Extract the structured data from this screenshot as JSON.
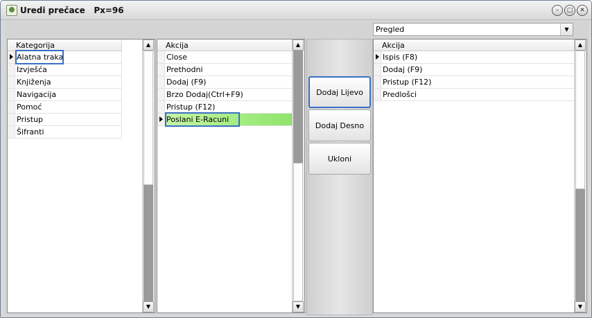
{
  "window": {
    "title": "Uredi prečace   Px=96",
    "minimize_label": "–",
    "maximize_label": "□",
    "close_label": "✕"
  },
  "dropdown": {
    "selected": "Pregled",
    "arrow": "▼"
  },
  "category_grid": {
    "header": "Kategorija",
    "rows": [
      "Alatna traka",
      "Izvješća",
      "Knjiženja",
      "Navigacija",
      "Pomoć",
      "Pristup",
      "Šifranti"
    ],
    "current_index": 0
  },
  "action_grid": {
    "header": "Akcija",
    "rows": [
      "Close",
      "Prethodni",
      "Dodaj (F9)",
      "Brzo Dodaj(Ctrl+F9)",
      "Pristup (F12)",
      "Poslani E-Racuni"
    ],
    "current_index": 5
  },
  "buttons": {
    "add_left": "Dodaj Lijevo",
    "add_right": "Dodaj Desno",
    "remove": "Ukloni"
  },
  "shortcut_grid": {
    "header": "Akcija",
    "rows": [
      "Ispis (F8)",
      "Dodaj (F9)",
      "Pristup (F12)",
      "Predlošci"
    ],
    "current_index": 0
  },
  "scroll": {
    "up": "▲",
    "down": "▼"
  }
}
